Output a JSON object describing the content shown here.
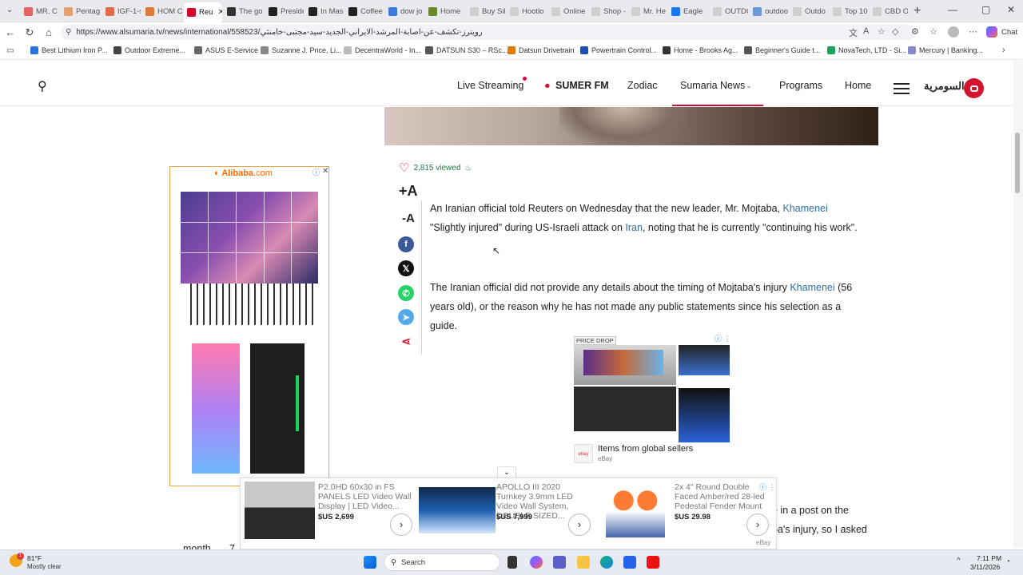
{
  "browser": {
    "tabs": [
      {
        "label": "MR, C",
        "color": "#e46464"
      },
      {
        "label": "Pentag",
        "color": "#e0a070"
      },
      {
        "label": "IGF-1-s",
        "color": "#e06a4a"
      },
      {
        "label": "HOM C",
        "color": "#e07a3a"
      },
      {
        "label": "Reu",
        "color": "#d6002a",
        "active": true
      },
      {
        "label": "The go",
        "color": "#333333"
      },
      {
        "label": "Preside",
        "color": "#222222"
      },
      {
        "label": "In Mass",
        "color": "#222222"
      },
      {
        "label": "Coffee",
        "color": "#222222"
      },
      {
        "label": "dow jo",
        "color": "#3b7be0"
      },
      {
        "label": "Home",
        "color": "#6a8a2a"
      },
      {
        "label": "Buy Sil",
        "color": "#cfcfcf"
      },
      {
        "label": "Hootlo",
        "color": "#cfcfcf"
      },
      {
        "label": "Online",
        "color": "#cfcfcf"
      },
      {
        "label": "Shop -",
        "color": "#cfcfcf"
      },
      {
        "label": "Mr. He",
        "color": "#cfcfcf"
      },
      {
        "label": "Eagle",
        "color": "#1877f2"
      },
      {
        "label": "OUTDC",
        "color": "#cfcfcf"
      },
      {
        "label": "outdoo",
        "color": "#6a9ad6"
      },
      {
        "label": "Outdo",
        "color": "#cfcfcf"
      },
      {
        "label": "Top 10",
        "color": "#cfcfcf"
      },
      {
        "label": "CBD O",
        "color": "#cfcfcf"
      }
    ],
    "url": "https://www.alsumaria.tv/news/international/558523/رويترز-تكشف-عن-اصابة-المرشد-الايراني-الجديد-سيد-مجتبى-خامنئي",
    "chat_label": "Chat",
    "bookmarks": [
      "Best Lithium Iron P...",
      "Outdoor Extreme...",
      "ASUS E-Service",
      "Suzanne J. Price, Li...",
      "DecentraWorld - In...",
      "DATSUN S30 – RSc...",
      "Datsun Drivetrain",
      "Powertrain Control...",
      "Home - Brooks Ag...",
      "Beginner's Guide t...",
      "NovaTech, LTD - Si...",
      "Mercury | Banking..."
    ]
  },
  "site": {
    "logo_text": "السومرية",
    "nav": {
      "live": "Live Streaming",
      "sumer": "SUMER FM",
      "zodiac": "Zodiac",
      "news": "Sumaria News",
      "programs": "Programs",
      "home": "Home"
    }
  },
  "ad_left": {
    "brand": "Alibaba",
    "domain": ".com"
  },
  "article": {
    "views": "2,815 viewed",
    "font_up": "+A",
    "font_down": "-A",
    "p1_a": "An Iranian official told Reuters on Wednesday that the new leader, Mr. Mojtaba, ",
    "p1_k1": "Khamenei",
    "p1_b": " \"Slightly injured\" during US-Israeli attack on ",
    "p1_k2": "Iran",
    "p1_c": ", noting that he is currently \"continuing his work\".",
    "p2_a": "The Iranian official did not provide any details about the timing of Mojtaba's injury ",
    "p2_k1": "Khamenei",
    "p2_b": " (56 years old), or the reason why he has not made any public statements since his selection as a guide.",
    "frag1": "e in a post on the",
    "frag2": "ba's injury, so I asked",
    "frag3": "month",
    "frag4": "7"
  },
  "ad_mid": {
    "badge": "PRICE DROP",
    "title": "Items from global sellers",
    "source": "eBay",
    "logo": "ebay"
  },
  "ad_bottom": {
    "items": [
      {
        "title": "P2.0HD 60x30 in FS PANELS LED Video Wall Display | LED Video...",
        "price": "$US 2,699"
      },
      {
        "title": "APOLLO III 2020 Turnkey 3.9mm LED Video Wall System, DOUBLE SIZED...",
        "price": "$US 7,999"
      },
      {
        "title": "2x 4\" Round Double Faced Amber/red 28-led Pedestal Fender Mount",
        "price": "$US 29.98"
      }
    ],
    "source": "eBay"
  },
  "taskbar": {
    "temp": "81°F",
    "weather": "Mostly clear",
    "search": "Search",
    "time": "7:11 PM",
    "date": "3/11/2026",
    "badge": "1"
  }
}
